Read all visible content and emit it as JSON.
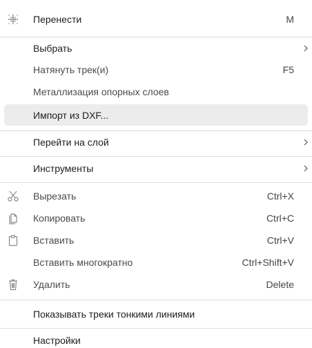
{
  "menu": {
    "items": [
      {
        "label": "Перенести",
        "shortcut": "M",
        "icon": "move-icon"
      },
      {
        "label": "Выбрать",
        "submenu": true
      },
      {
        "label": "Натянуть трек(и)",
        "shortcut": "F5"
      },
      {
        "label": "Металлизация опорных слоев"
      },
      {
        "label": "Импорт из DXF...",
        "highlighted": true
      },
      {
        "label": "Перейти на слой",
        "submenu": true
      },
      {
        "label": "Инструменты",
        "submenu": true
      },
      {
        "label": "Вырезать",
        "shortcut": "Ctrl+X",
        "icon": "scissors-icon"
      },
      {
        "label": "Копировать",
        "shortcut": "Ctrl+C",
        "icon": "copy-icon"
      },
      {
        "label": "Вставить",
        "shortcut": "Ctrl+V",
        "icon": "clipboard-icon"
      },
      {
        "label": "Вставить многократно",
        "shortcut": "Ctrl+Shift+V"
      },
      {
        "label": "Удалить",
        "shortcut": "Delete",
        "icon": "trash-icon"
      },
      {
        "label": "Показывать треки тонкими линиями"
      },
      {
        "label": "Настройки"
      }
    ]
  },
  "colors": {
    "background": "#ffffff",
    "highlight": "#ececec",
    "separator": "#dcdcdc",
    "text": "#1f1f1f",
    "icon": "#8a8a8a"
  }
}
